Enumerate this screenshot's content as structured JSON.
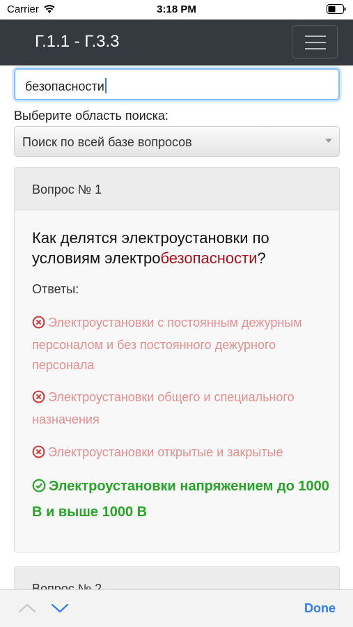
{
  "status_bar": {
    "carrier": "Carrier",
    "time": "3:18 PM"
  },
  "navbar": {
    "title": "Г.1.1 - Г.3.3"
  },
  "search": {
    "value": "безопасности"
  },
  "area": {
    "label": "Выберите область поиска:",
    "selected": "Поиск по всей базе вопросов"
  },
  "questions": [
    {
      "header": "Вопрос № 1",
      "text_before": "Как делятся электроустановки по условиям электро",
      "text_highlight": "безопасности",
      "text_after": "?",
      "answers_label": "Ответы:",
      "answers": [
        {
          "text": "Электроустановки с постоянным дежурным персоналом и без постоянного дежурного персонала",
          "correct": false
        },
        {
          "text": "Электроустановки общего и специального назначения",
          "correct": false
        },
        {
          "text": "Электроустановки открытые и закрытые",
          "correct": false
        },
        {
          "text": "Электроустановки напряжением до 1000 В и выше 1000 В",
          "correct": true
        }
      ]
    },
    {
      "header": "Вопрос № 2"
    }
  ],
  "keyboard_bar": {
    "done_label": "Done"
  },
  "colors": {
    "navbar": "#343a40",
    "highlight": "#b00f18",
    "wrong": "#e58e8e",
    "correct": "#27a527",
    "done": "#2f7cf6"
  }
}
